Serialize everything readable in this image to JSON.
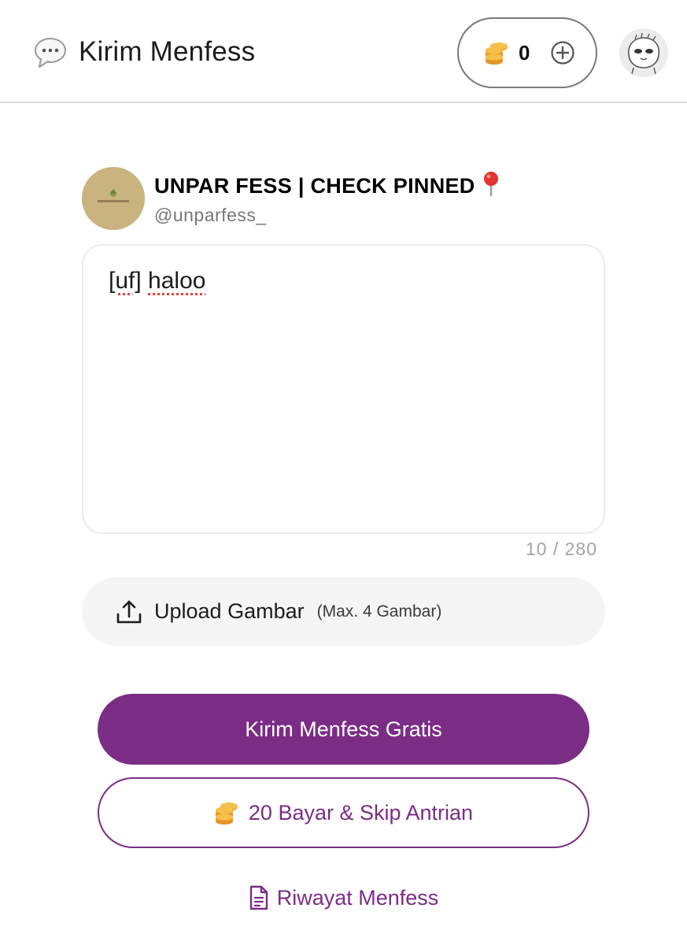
{
  "header": {
    "title": "Kirim Menfess",
    "coin_balance": "0"
  },
  "account": {
    "name": "UNPAR FESS | CHECK PINNED",
    "handle": "@unparfess_"
  },
  "composer": {
    "text_tag": "[uf]",
    "text_word": "haloo",
    "char_count": "10 / 280"
  },
  "upload": {
    "label": "Upload Gambar",
    "hint": "(Max. 4 Gambar)"
  },
  "actions": {
    "primary_label": "Kirim Menfess Gratis",
    "secondary_label": "20 Bayar & Skip Antrian",
    "history_label": "Riwayat Menfess"
  },
  "colors": {
    "brand_purple": "#7b2d86",
    "coin_gold": "#f0a632"
  },
  "icons": {
    "title": "speech-bubble-icon",
    "coins": "coins-icon",
    "plus": "plus-circle-icon",
    "pin": "pushpin-icon",
    "upload": "upload-icon",
    "history": "document-icon"
  }
}
